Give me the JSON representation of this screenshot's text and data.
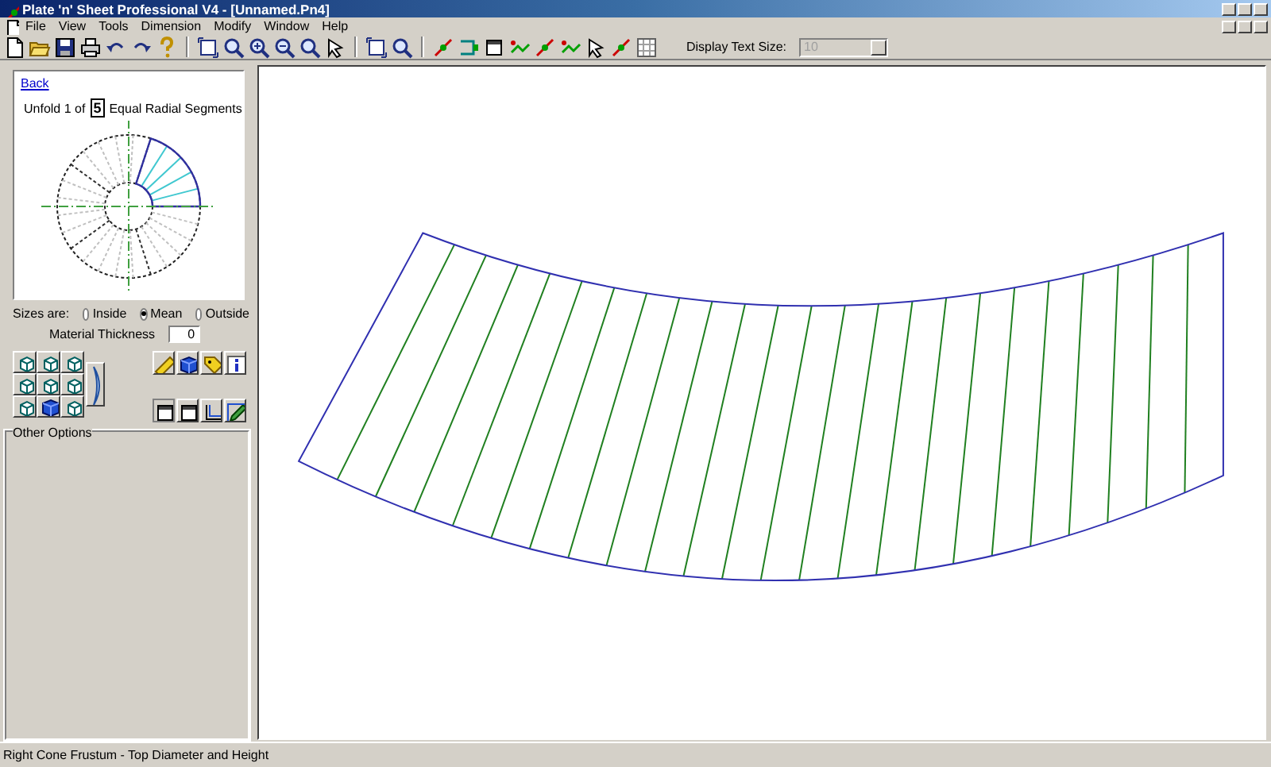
{
  "window": {
    "title": "Plate 'n' Sheet Professional V4 - [Unnamed.Pn4]"
  },
  "menu": [
    "File",
    "View",
    "Tools",
    "Dimension",
    "Modify",
    "Window",
    "Help"
  ],
  "toolbar": {
    "display_text_size": {
      "label": "Display Text Size:",
      "value": "10",
      "disabled": true
    }
  },
  "panel": {
    "back_link": "Back",
    "unfold": {
      "prefix": "Unfold 1 of",
      "count": "5",
      "suffix": "Equal Radial Segments"
    },
    "sizes": {
      "label": "Sizes are:",
      "options": [
        {
          "label": "Inside",
          "selected": false
        },
        {
          "label": "Mean",
          "selected": true
        },
        {
          "label": "Outside",
          "selected": false
        }
      ]
    },
    "material_thickness": {
      "label": "Material Thickness",
      "value": "0"
    },
    "other_options": {
      "title": "Other Options"
    }
  },
  "status_bar": "Right Cone Frustum - Top Diameter and Height"
}
